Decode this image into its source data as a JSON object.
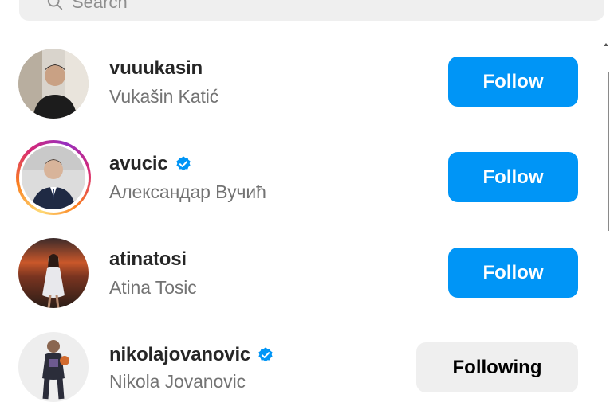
{
  "search": {
    "placeholder": "Search",
    "icon": "search-icon"
  },
  "colors": {
    "follow_button": "#0095f6",
    "following_button": "#efefef",
    "verified": "#0095f6",
    "secondary_text": "#737373"
  },
  "users": [
    {
      "username": "vuuukasin",
      "full_name": "Vukašin Katić",
      "verified": false,
      "story_ring": false,
      "button_label": "Follow"
    },
    {
      "username": "avucic",
      "full_name": "Александар Вучић",
      "verified": true,
      "story_ring": true,
      "button_label": "Follow"
    },
    {
      "username": "atinatosi_",
      "full_name": "Atina Tosic",
      "verified": false,
      "story_ring": false,
      "button_label": "Follow"
    },
    {
      "username": "nikolajovanovic",
      "full_name": "Nikola Jovanovic",
      "verified": true,
      "story_ring": false,
      "button_label": "Following"
    }
  ]
}
